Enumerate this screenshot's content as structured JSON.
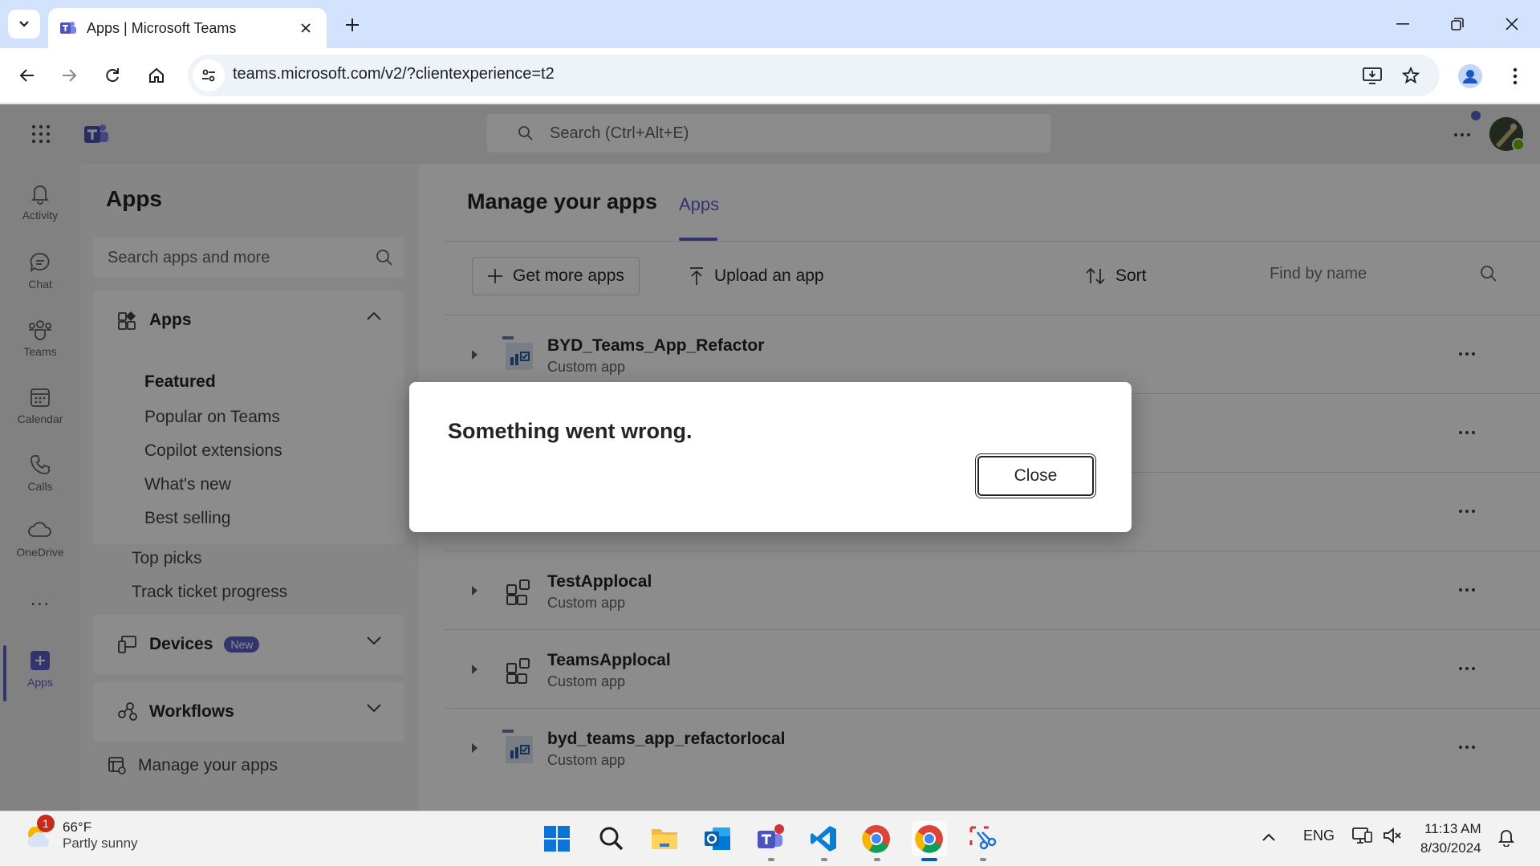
{
  "browser": {
    "tab_title": "Apps | Microsoft Teams",
    "url": "teams.microsoft.com/v2/?clientexperience=t2"
  },
  "teams": {
    "search_placeholder": "Search (Ctrl+Alt+E)",
    "rail": [
      {
        "label": "Activity",
        "icon": "bell-icon"
      },
      {
        "label": "Chat",
        "icon": "chat-icon"
      },
      {
        "label": "Teams",
        "icon": "teams-icon"
      },
      {
        "label": "Calendar",
        "icon": "calendar-icon"
      },
      {
        "label": "Calls",
        "icon": "phone-icon"
      },
      {
        "label": "OneDrive",
        "icon": "cloud-icon"
      },
      {
        "label": "Apps",
        "icon": "plus-square-icon",
        "active": true
      }
    ],
    "rail_more": "...",
    "left_pane": {
      "title": "Apps",
      "search_placeholder": "Search apps and more",
      "apps_section": "Apps",
      "featured": "Featured",
      "categories": [
        "Popular on Teams",
        "Copilot extensions",
        "What's new",
        "Best selling",
        "Top picks",
        "Track ticket progress"
      ],
      "devices_section": "Devices",
      "devices_badge": "New",
      "workflows_section": "Workflows",
      "manage_link": "Manage your apps"
    },
    "main": {
      "title": "Manage your apps",
      "tab": "Apps",
      "get_more_apps": "Get more apps",
      "upload_app": "Upload an app",
      "sort": "Sort",
      "find_placeholder": "Find by name",
      "more_label": "...",
      "rows": [
        {
          "name": "BYD_Teams_App_Refactor",
          "type": "Custom app",
          "icon": "custom-app-logo-icon"
        },
        {
          "name": "",
          "type": "",
          "icon": ""
        },
        {
          "name": "",
          "type": "",
          "icon": ""
        },
        {
          "name": "TestApplocal",
          "type": "Custom app",
          "icon": "app-grid-icon"
        },
        {
          "name": "TeamsApplocal",
          "type": "Custom app",
          "icon": "app-grid-icon"
        },
        {
          "name": "byd_teams_app_refactorlocal",
          "type": "Custom app",
          "icon": "custom-app-logo-icon"
        }
      ]
    }
  },
  "dialog": {
    "title": "Something went wrong.",
    "close_label": "Close"
  },
  "taskbar": {
    "weather_temp": "66°F",
    "weather_desc": "Partly sunny",
    "weather_badge": "1",
    "language": "ENG",
    "time": "11:13 AM",
    "date": "8/30/2024"
  },
  "colors": {
    "accent": "#5b5fc7",
    "chrome_tabstrip": "#d3e3fd",
    "overlay": "rgba(0,0,0,0.45)"
  }
}
